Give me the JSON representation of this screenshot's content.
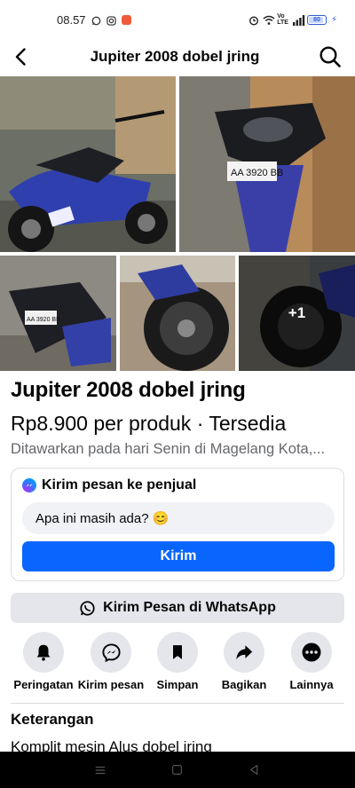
{
  "status_bar": {
    "time": "08.57",
    "network_label_top": "Vo",
    "network_label_bottom": "LTE",
    "battery_level_text": "80",
    "battery_fraction": 0.8
  },
  "header": {
    "title": "Jupiter 2008 dobel jring",
    "back_icon": "back-arrow-icon",
    "search_icon": "search-icon"
  },
  "photos": {
    "extra_count_label": "+1",
    "plate_text": "AA 3920 BB"
  },
  "listing": {
    "title": "Jupiter 2008 dobel jring",
    "price": "Rp8.900 per produk · Tersedia",
    "offered": "Ditawarkan pada hari Senin di Magelang Kota,..."
  },
  "message_card": {
    "heading": "Kirim pesan ke penjual",
    "input_value": "Apa ini masih ada? 😊",
    "send_label": "Kirim"
  },
  "whatsapp": {
    "label": "Kirim Pesan di WhatsApp"
  },
  "actions": [
    {
      "label": "Peringatan",
      "icon": "bell-icon"
    },
    {
      "label": "Kirim pesan",
      "icon": "messenger-icon"
    },
    {
      "label": "Simpan",
      "icon": "bookmark-icon"
    },
    {
      "label": "Bagikan",
      "icon": "share-icon"
    },
    {
      "label": "Lainnya",
      "icon": "more-icon"
    }
  ],
  "description": {
    "title": "Keterangan",
    "body": "Komplit mesin Alus dobel jring"
  },
  "colors": {
    "primary_blue": "#0866ff",
    "secondary_gray": "#e4e6eb",
    "muted_text": "#65676b"
  }
}
